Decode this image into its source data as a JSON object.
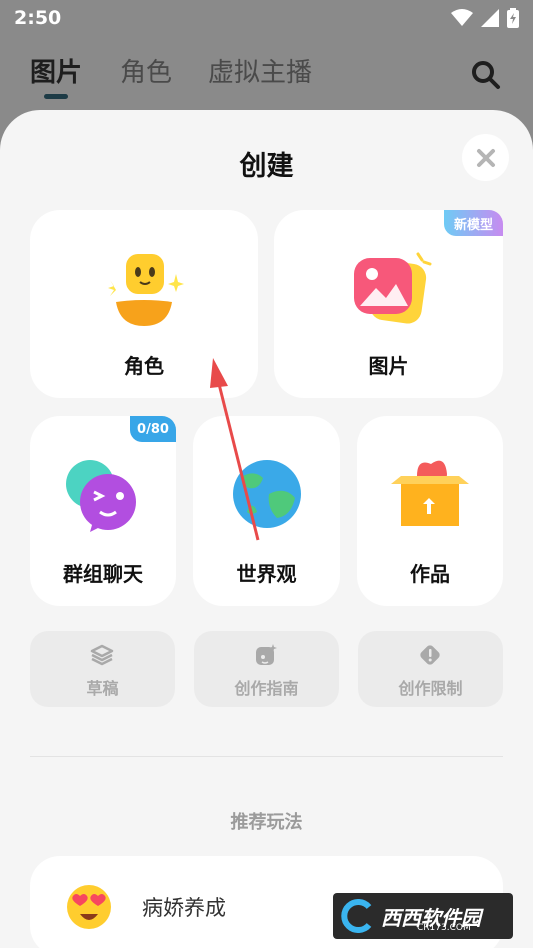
{
  "status": {
    "time": "2:50"
  },
  "top_tabs": [
    {
      "label": "图片",
      "active": true
    },
    {
      "label": "角色",
      "active": false
    },
    {
      "label": "虚拟主播",
      "active": false
    }
  ],
  "sheet": {
    "title": "创建",
    "close_icon": "close-icon",
    "main_cards": [
      {
        "label": "角色",
        "icon": "character-emoji-icon"
      },
      {
        "label": "图片",
        "icon": "image-icon",
        "badge": "新模型"
      }
    ],
    "mid_cards": [
      {
        "label": "群组聊天",
        "icon": "group-chat-icon",
        "badge": "0/80"
      },
      {
        "label": "世界观",
        "icon": "globe-icon"
      },
      {
        "label": "作品",
        "icon": "works-box-icon"
      }
    ],
    "small_cards": [
      {
        "label": "草稿",
        "icon": "layers-icon"
      },
      {
        "label": "创作指南",
        "icon": "guide-icon"
      },
      {
        "label": "创作限制",
        "icon": "warning-icon"
      }
    ],
    "section_title": "推荐玩法",
    "recommend": {
      "label": "病娇养成",
      "icon": "heart-eyes-emoji-icon"
    }
  },
  "watermark": {
    "text": "西西软件园",
    "sub": "CR173.COM"
  },
  "colors": {
    "accent_blue": "#38a6e8",
    "badge_gradient_start": "#6ecbf5",
    "badge_gradient_end": "#c78bf0",
    "arrow_red": "#e84a4a"
  }
}
